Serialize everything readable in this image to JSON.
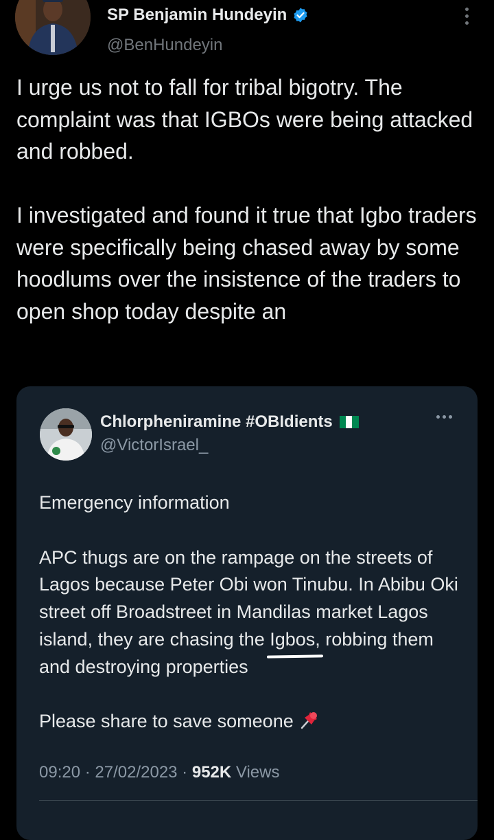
{
  "tweet": {
    "author": {
      "name": "SP Benjamin Hundeyin",
      "handle": "@BenHundeyin",
      "verified_color": "#1d9bf0"
    },
    "text": "I urge us not to fall for tribal bigotry. The complaint was that IGBOs were being attacked and robbed.\n\nI investigated and found it true that Igbo traders were specifically being chased away by some hoodlums over the insistence of the traders to open shop today despite an",
    "menu_icon": "more-vertical-icon"
  },
  "quoted": {
    "author": {
      "name": "Chlorpheniramine #OBIdients",
      "handle": "@VictorIsrael_",
      "flag_colors": [
        "#008751",
        "#ffffff",
        "#008751"
      ]
    },
    "paragraphs": {
      "p1": "Emergency information",
      "p2_before": "APC thugs are on the rampage on the streets of Lagos because Peter Obi won Tinubu. In Abibu Oki street off Broadstreet in Mandilas market Lagos island, they are chasing the ",
      "p2_highlight": "Igbos,",
      "p2_after": " robbing them and destroying properties",
      "p3": "Please share to save someone"
    },
    "meta": {
      "time": "09:20",
      "sep1": " · ",
      "date": "27/02/2023",
      "sep2": " · ",
      "views_count": "952K",
      "views_label": " Views"
    },
    "menu_icon": "more-horizontal-icon"
  },
  "colors": {
    "background": "#000000",
    "card": "#15202b",
    "text": "#e7e9ea",
    "muted": "#71767b",
    "verified": "#1d9bf0"
  }
}
